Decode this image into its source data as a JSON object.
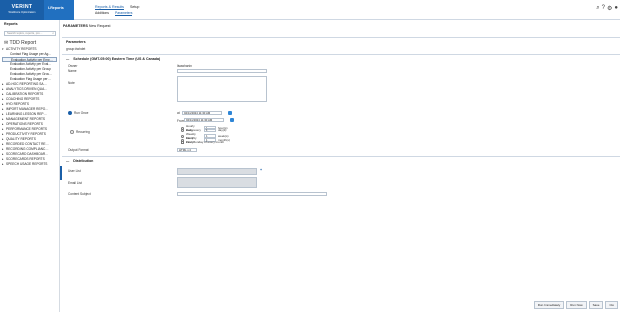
{
  "header": {
    "brand": "VERINT",
    "brand_sub": "Workforce Optimization",
    "app_name": "I-Reports",
    "nav_primary": [
      "Reports & Results",
      "Setup"
    ],
    "nav_secondary": [
      "Additions",
      "Parameters"
    ],
    "icons": [
      "search-icon",
      "help-icon",
      "settings-icon",
      "user-icon"
    ]
  },
  "sidebar": {
    "title": "Reports",
    "search_placeholder": "Search topics, reports, pro…",
    "root_label": "✉ TDD Report",
    "items": [
      {
        "label": "ACTIVITY REPORTS",
        "kind": "open"
      },
      {
        "label": "Contact Flag Usage per Ag…",
        "kind": "child"
      },
      {
        "label": "Evaluation Activity per Emp…",
        "kind": "child-sel"
      },
      {
        "label": "Evaluation Activity per Eval…",
        "kind": "child"
      },
      {
        "label": "Evaluation Activity per Group",
        "kind": "child"
      },
      {
        "label": "Evaluation Activity per Grou…",
        "kind": "child"
      },
      {
        "label": "Evaluation Flag Usage per…",
        "kind": "child"
      },
      {
        "label": "AD-HOC REPORTING SA…",
        "kind": "closed"
      },
      {
        "label": "ANALYTICS DRIVEN QUA…",
        "kind": "closed"
      },
      {
        "label": "CALIBRATION REPORTS",
        "kind": "closed"
      },
      {
        "label": "COACHING REPORTS",
        "kind": "closed"
      },
      {
        "label": "HYD REPORTS",
        "kind": "closed"
      },
      {
        "label": "IMPORT MANAGER REPO…",
        "kind": "closed"
      },
      {
        "label": "LEARNING LESSON REP…",
        "kind": "closed"
      },
      {
        "label": "MANAGEMENT REPORTS",
        "kind": "closed"
      },
      {
        "label": "OPERATIONS REPORTS",
        "kind": "closed"
      },
      {
        "label": "PERFORMANCE REPORTS",
        "kind": "closed"
      },
      {
        "label": "PRODUCTIVITY REPORTS",
        "kind": "closed"
      },
      {
        "label": "QUALITY REPORTS",
        "kind": "closed"
      },
      {
        "label": "RECORDED CONTACT RE…",
        "kind": "closed"
      },
      {
        "label": "RECORDING COMPLIANC…",
        "kind": "closed"
      },
      {
        "label": "SCORECARD DASHBOAR…",
        "kind": "closed"
      },
      {
        "label": "SCORECARDS REPORTS",
        "kind": "closed"
      },
      {
        "label": "SPEECH USAGE REPORTS",
        "kind": "closed"
      }
    ]
  },
  "main": {
    "title_bold": "PARAMETERS",
    "title_rest": " New Request",
    "parameters_label": "Parameters",
    "parameters_value": "group:#whdet",
    "schedule_section": "Schedule (GMT-05:00) Eastern Time (US & Canada)",
    "owner_label": "Owner",
    "owner_value": "lisawhanin",
    "name_label": "Name",
    "note_label": "Note",
    "run_once_label": "Run Once",
    "run_once_at": "at",
    "run_once_datetime": "04/11/2024 11:30 AM",
    "recurring_label": "Recurring",
    "from_label": "From",
    "from_datetime": "04/11/2024 11:30 AM",
    "recurring_options": [
      {
        "label": "Hourly every",
        "num": "1",
        "unit": "hour(s)",
        "kind": "dot"
      },
      {
        "label": "Daily every",
        "num": "1",
        "unit": "day(s)",
        "kind": "dot"
      },
      {
        "label": "Weekly every",
        "num": "1",
        "unit": "week(s)",
        "kind": "dot"
      },
      {
        "label": "Monthly every",
        "num": "1",
        "unit": "month(s)",
        "kind": "dot"
      },
      {
        "label": "First Monday of every month",
        "num": "",
        "unit": "",
        "kind": "box"
      }
    ],
    "output_format_label": "Output Format",
    "output_format_value": "HTML v.4",
    "distribution_section": "Distribution",
    "user_list_label": "User List",
    "email_list_label": "Email List",
    "content_subject_label": "Content Subject",
    "plus_sign": "+"
  },
  "footer": {
    "buttons": [
      "Run Immediately",
      "Run Now",
      "Save",
      "Clo"
    ]
  },
  "colors": {
    "brand": "#1a5fa8",
    "accent": "#2f86d6"
  }
}
